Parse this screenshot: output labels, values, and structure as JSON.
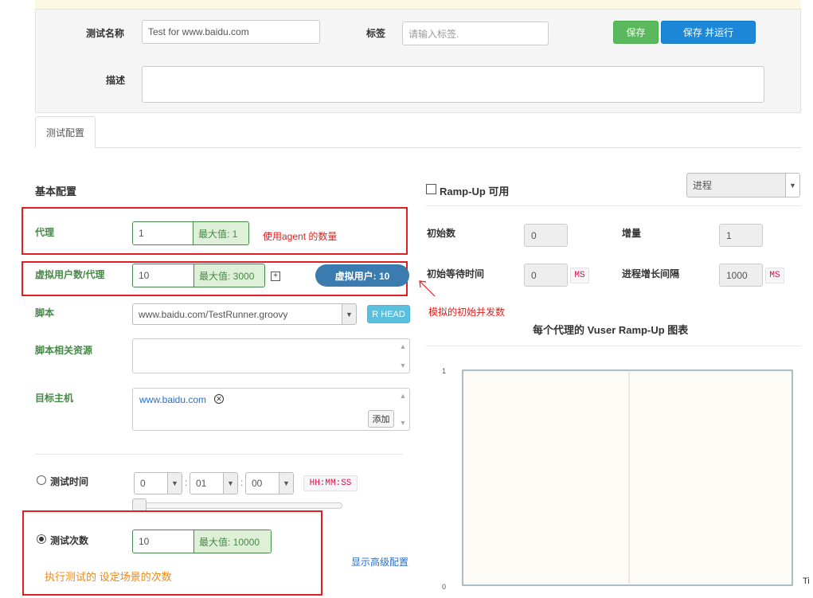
{
  "form": {
    "test_name_label": "测试名称",
    "test_name_value": "Test for www.baidu.com",
    "tag_label": "标签",
    "tag_placeholder": "请输入标签.",
    "save_label": "保存",
    "save_run_label": "保存 并运行",
    "description_label": "描述"
  },
  "tabs": [
    {
      "label": "测试配置"
    }
  ],
  "basic": {
    "title": "基本配置",
    "agent_label": "代理",
    "agent_value": "1",
    "agent_max": "最大值: 1",
    "agent_note": "使用agent 的数量",
    "vuser_label": "虚拟用户数/代理",
    "vuser_value": "10",
    "vuser_max": "最大值: 3000",
    "vuser_expand": "+",
    "vuser_pill": "虚拟用户: 10",
    "vuser_note": "模拟的初始并发数",
    "script_label": "脚本",
    "script_value": "www.baidu.com/TestRunner.groovy",
    "rhead_label": "R HEAD",
    "resources_label": "脚本相关资源",
    "target_label": "目标主机",
    "target_value": "www.baidu.com",
    "target_add": "添加",
    "duration_label": "测试时间",
    "duration_h": "0",
    "duration_m": "01",
    "duration_s": "00",
    "duration_sep": ":",
    "duration_format": "HH:MM:SS",
    "count_label": "测试次数",
    "count_value": "10",
    "count_max": "最大值: 10000",
    "count_note": "执行测试的 设定场景的次数",
    "advanced_link": "显示高级配置"
  },
  "rampup": {
    "enable_label": "Ramp-Up 可用",
    "mode_value": "进程",
    "initial_label": "初始数",
    "initial_value": "0",
    "increment_label": "增量",
    "increment_value": "1",
    "initial_wait_label": "初始等待时间",
    "initial_wait_value": "0",
    "initial_wait_unit": "MS",
    "interval_label": "进程增长间隔",
    "interval_value": "1000",
    "interval_unit": "MS",
    "chart_title": "每个代理的 Vuser Ramp-Up 图表"
  },
  "chart_data": {
    "type": "line",
    "title": "每个代理的 Vuser Ramp-Up 图表",
    "xlabel": "",
    "ylabel": "",
    "ytick_labels": [
      "1",
      "0"
    ],
    "ylim": [
      0,
      1
    ],
    "series": []
  },
  "edge_text": "Ti",
  "colors": {
    "success": "#468847",
    "annotation": "#e02020",
    "primary": "#1e88d8",
    "save": "#5cb85c"
  }
}
